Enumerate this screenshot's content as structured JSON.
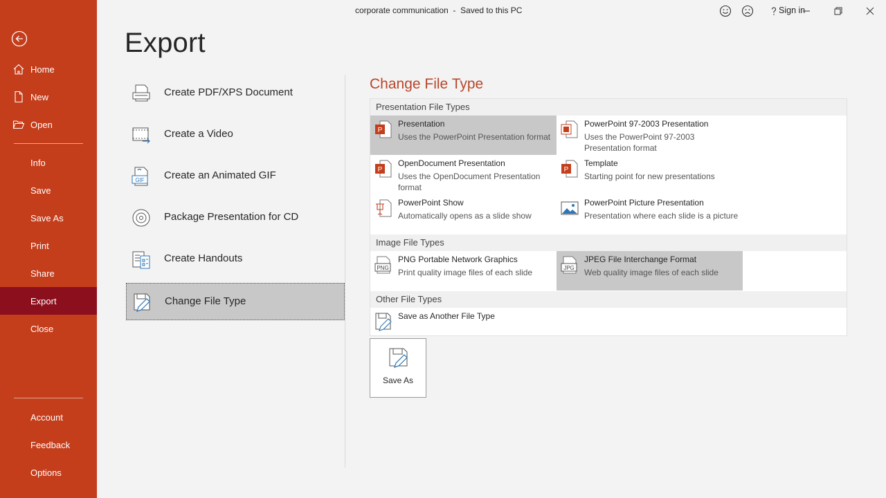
{
  "window": {
    "doc_title": "corporate communication  -  Saved to this PC",
    "signin": "Sign in"
  },
  "sidebar": {
    "items": [
      {
        "label": "Home"
      },
      {
        "label": "New"
      },
      {
        "label": "Open"
      },
      {
        "label": "Info"
      },
      {
        "label": "Save"
      },
      {
        "label": "Save As"
      },
      {
        "label": "Print"
      },
      {
        "label": "Share"
      },
      {
        "label": "Export"
      },
      {
        "label": "Close"
      },
      {
        "label": "Account"
      },
      {
        "label": "Feedback"
      },
      {
        "label": "Options"
      }
    ],
    "active": "Export"
  },
  "page_title": "Export",
  "export_options": [
    {
      "label": "Create PDF/XPS Document",
      "icon": "pdf-document-icon"
    },
    {
      "label": "Create a Video",
      "icon": "video-icon"
    },
    {
      "label": "Create an Animated GIF",
      "icon": "gif-icon"
    },
    {
      "label": "Package Presentation for CD",
      "icon": "cd-icon"
    },
    {
      "label": "Create Handouts",
      "icon": "handouts-icon"
    },
    {
      "label": "Change File Type",
      "icon": "change-file-type-icon"
    }
  ],
  "change_file_type": {
    "heading": "Change File Type",
    "groups": [
      {
        "title": "Presentation File Types",
        "items": [
          {
            "name": "Presentation",
            "desc": "Uses the PowerPoint Presentation format"
          },
          {
            "name": "PowerPoint 97-2003 Presentation",
            "desc": "Uses the PowerPoint 97-2003 Presentation format"
          },
          {
            "name": "OpenDocument Presentation",
            "desc": "Uses the OpenDocument Presentation format"
          },
          {
            "name": "Template",
            "desc": "Starting point for new presentations"
          },
          {
            "name": "PowerPoint Show",
            "desc": "Automatically opens as a slide show"
          },
          {
            "name": "PowerPoint Picture Presentation",
            "desc": "Presentation where each slide is a picture"
          }
        ]
      },
      {
        "title": "Image File Types",
        "items": [
          {
            "name": "PNG Portable Network Graphics",
            "desc": "Print quality image files of each slide",
            "badge": "PNG"
          },
          {
            "name": "JPEG File Interchange Format",
            "desc": "Web quality image files of each slide",
            "badge": "JPG"
          }
        ]
      },
      {
        "title": "Other File Types",
        "items": [
          {
            "name": "Save as Another File Type",
            "desc": ""
          }
        ]
      }
    ],
    "save_as_label": "Save As",
    "gif_badge": "GIF"
  },
  "colors": {
    "sidebar": "#c43e1c",
    "sidebar_active": "#8c0f1d",
    "accent_heading": "#b7472a",
    "selected": "#c8c8c8"
  }
}
